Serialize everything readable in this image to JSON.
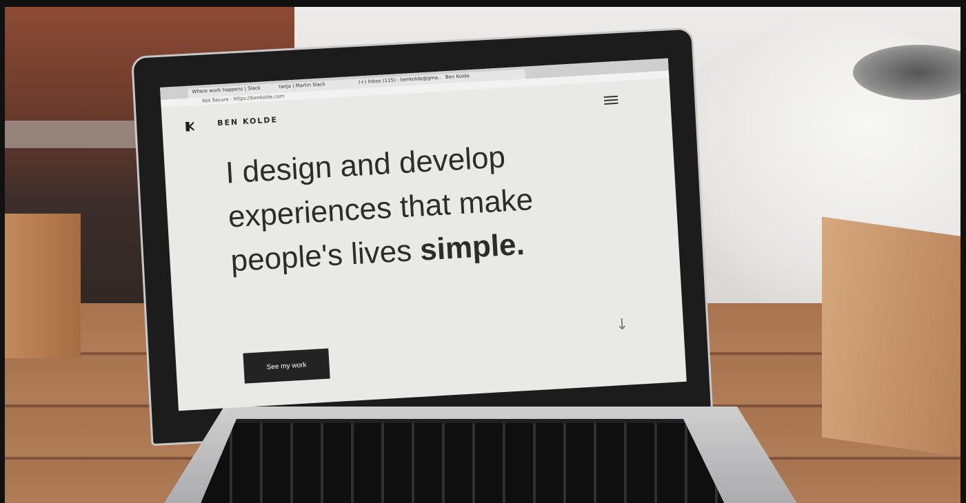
{
  "browser": {
    "tabs": [
      "Where work happens | Slack",
      "tanja | Martin Slack",
      "(+) Inbox (115) - benkolde@gma...",
      "Ben Kolde"
    ],
    "url": "Not Secure · https://benkolde.com"
  },
  "site": {
    "name": "BEN KOLDE",
    "headline_line1": "I design and develop",
    "headline_line2": "experiences that make",
    "headline_line3_normal": "people's lives ",
    "headline_line3_bold": "simple.",
    "cta_label": "See my work"
  },
  "icons": [
    "logo-k-icon",
    "menu-icon",
    "arrow-down-icon"
  ]
}
